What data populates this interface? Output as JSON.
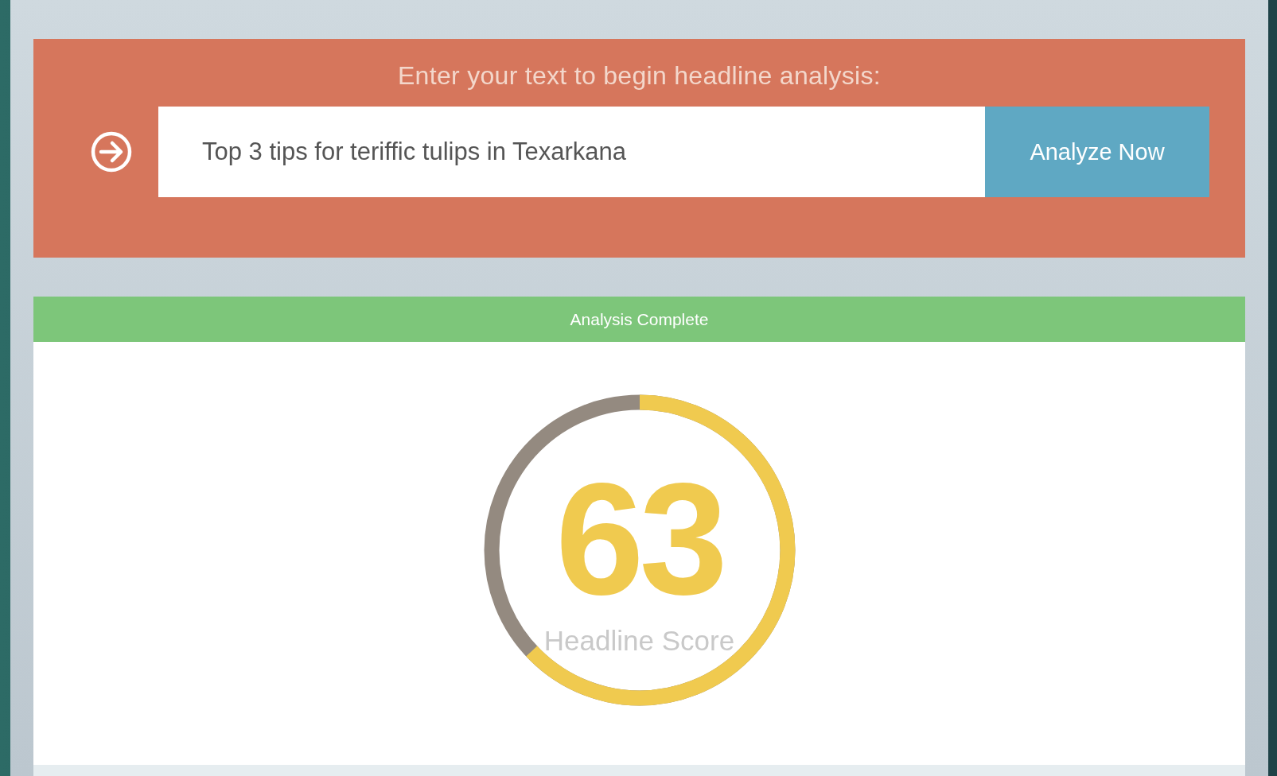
{
  "banner": {
    "prompt": "Enter your text to begin headline analysis:",
    "input_value": "Top 3 tips for teriffic tulips in Texarkana",
    "button": "Analyze Now"
  },
  "status": {
    "label": "Analysis Complete"
  },
  "score": {
    "value": "63",
    "label": "Headline Score",
    "level": 0.63
  }
}
